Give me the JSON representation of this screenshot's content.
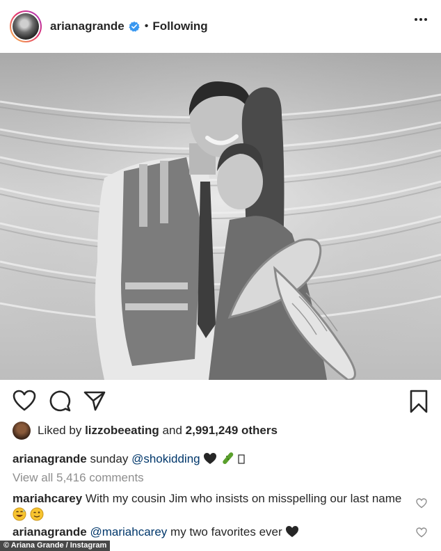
{
  "header": {
    "username": "arianagrande",
    "separator": "•",
    "follow_status": "Following"
  },
  "photo": {
    "description_icon": "post-photo"
  },
  "actions": {
    "like_icon": "heart-icon",
    "comment_icon": "comment-icon",
    "share_icon": "share-icon",
    "save_icon": "bookmark-icon"
  },
  "likes": {
    "prefix": "Liked by",
    "user": "lizzobeeating",
    "middle": "and",
    "count": "2,991,249 others"
  },
  "caption": {
    "username": "arianagrande",
    "text": "sunday",
    "mention": "@shokidding",
    "trailing": "🖤🥒 ▯"
  },
  "comments": {
    "view_all": "View all 5,416 comments",
    "items": [
      {
        "username": "mariahcarey",
        "text": "With my cousin Jim who insists on misspelling our last name"
      },
      {
        "username": "arianagrande",
        "mention": "@mariahcarey",
        "text": "my two favorites ever"
      }
    ]
  },
  "credit": "© Ariana Grande / Instagram",
  "colors": {
    "accent_link": "#00376b",
    "muted": "#8e8e8e",
    "verified": "#3897f0"
  }
}
